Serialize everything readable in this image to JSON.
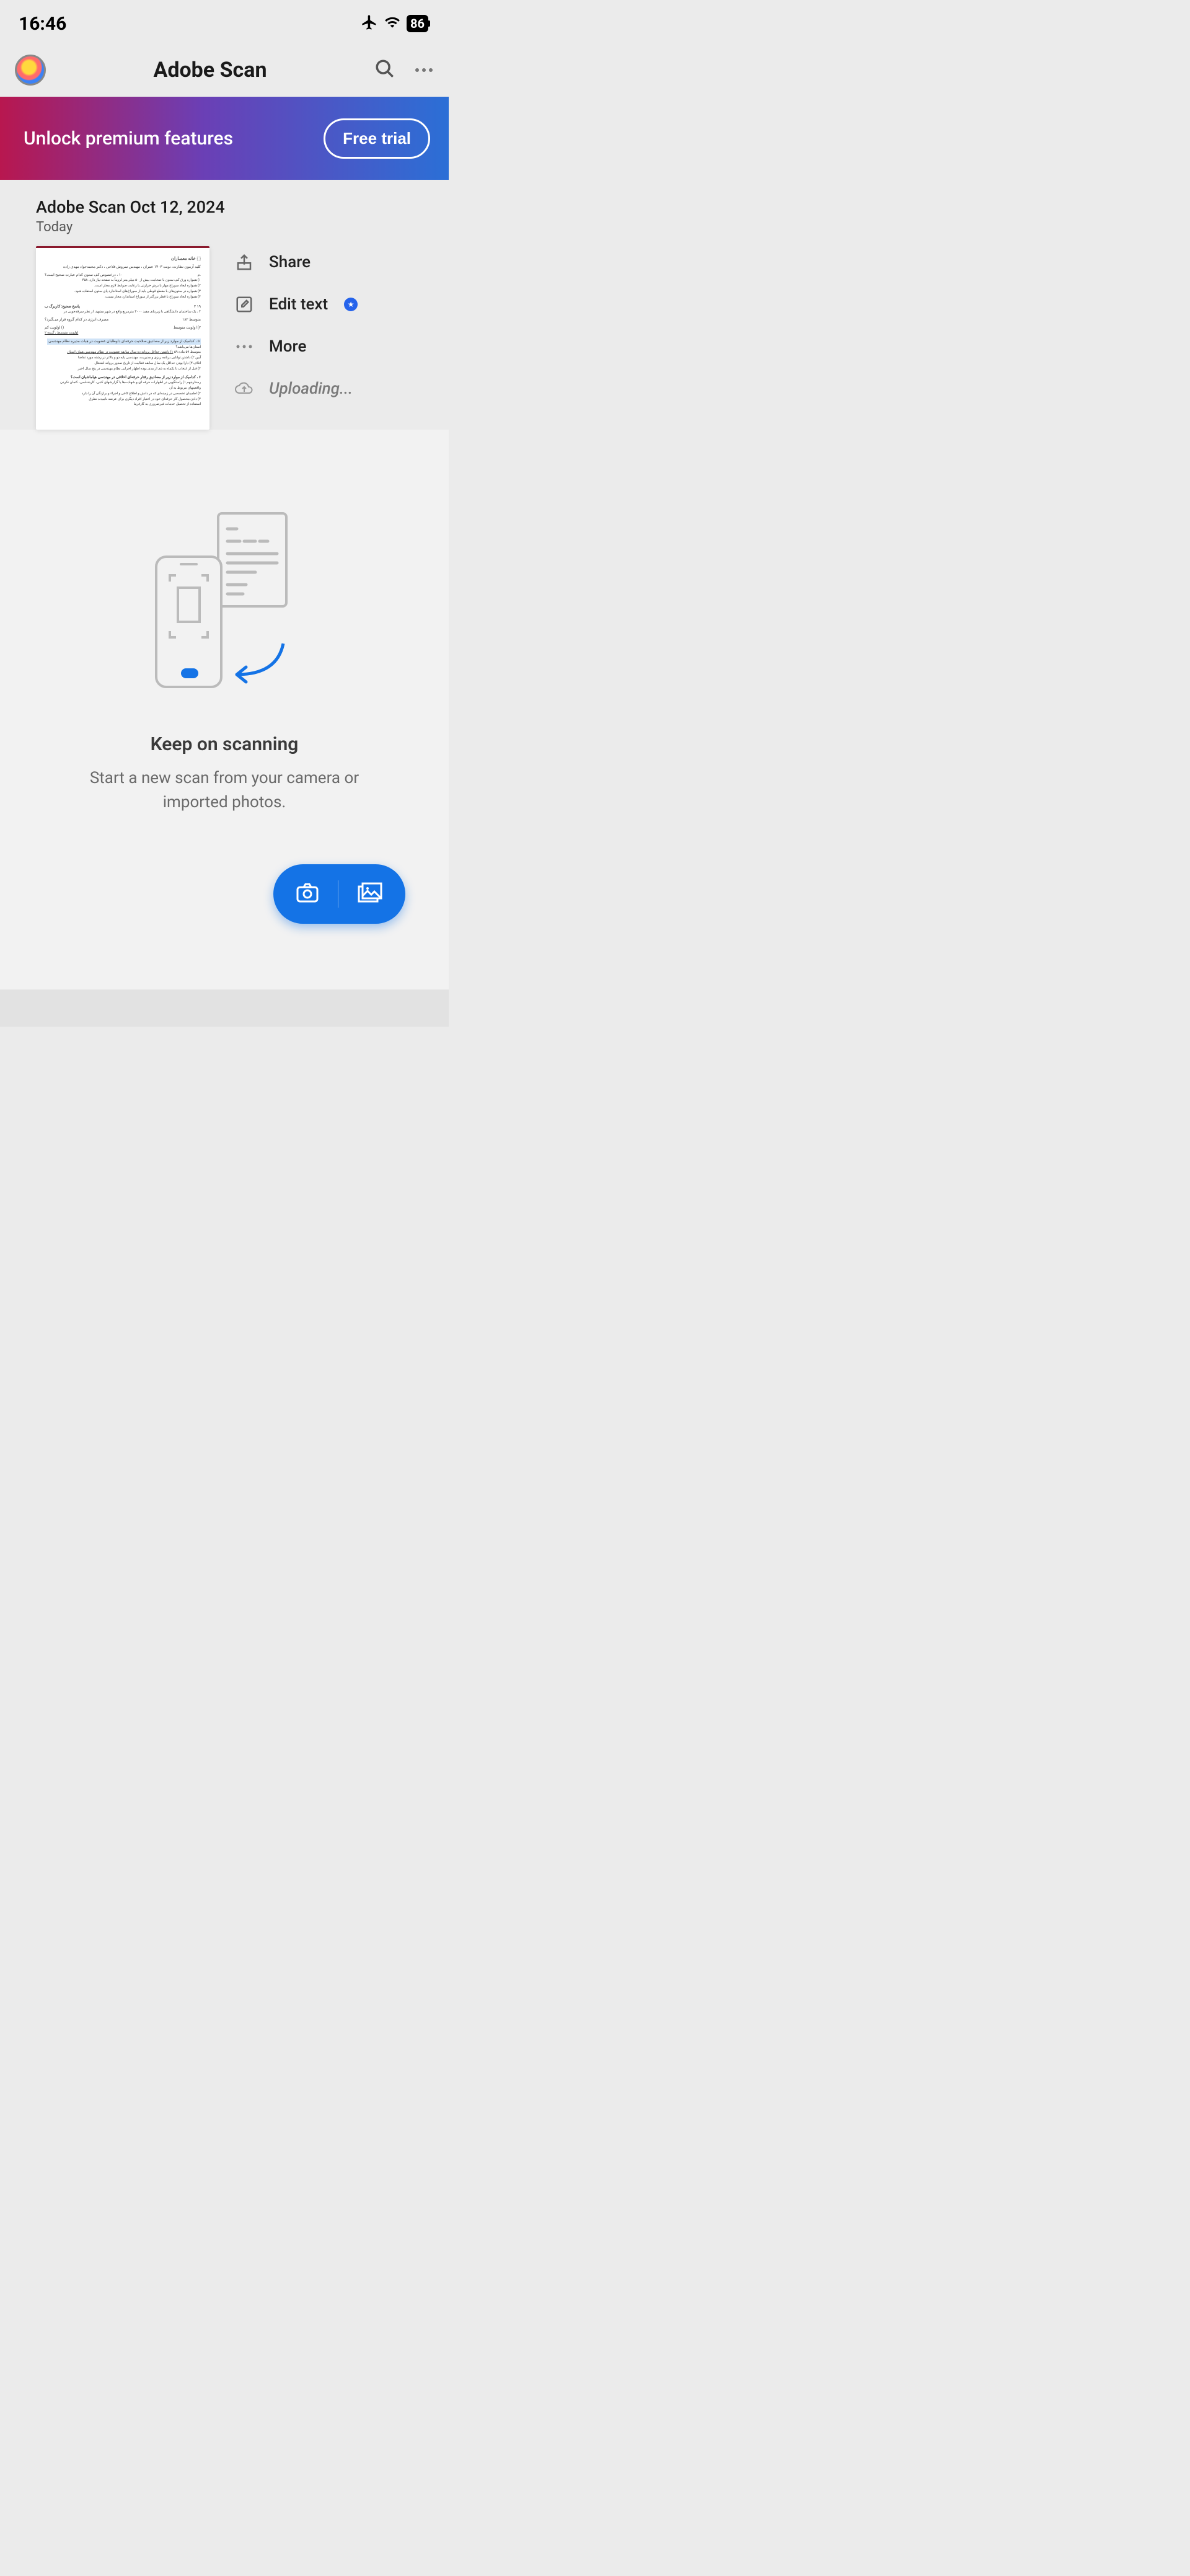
{
  "status": {
    "time": "16:46",
    "battery": "86"
  },
  "header": {
    "title": "Adobe Scan"
  },
  "promo": {
    "text": "Unlock premium features",
    "cta": "Free trial"
  },
  "document": {
    "title": "Adobe Scan Oct 12, 2024",
    "date_label": "Today",
    "actions": {
      "share": "Share",
      "edit": "Edit text",
      "more": "More",
      "status": "Uploading..."
    }
  },
  "empty_state": {
    "title": "Keep on scanning",
    "subtitle": "Start a new scan from your camera or imported photos."
  }
}
